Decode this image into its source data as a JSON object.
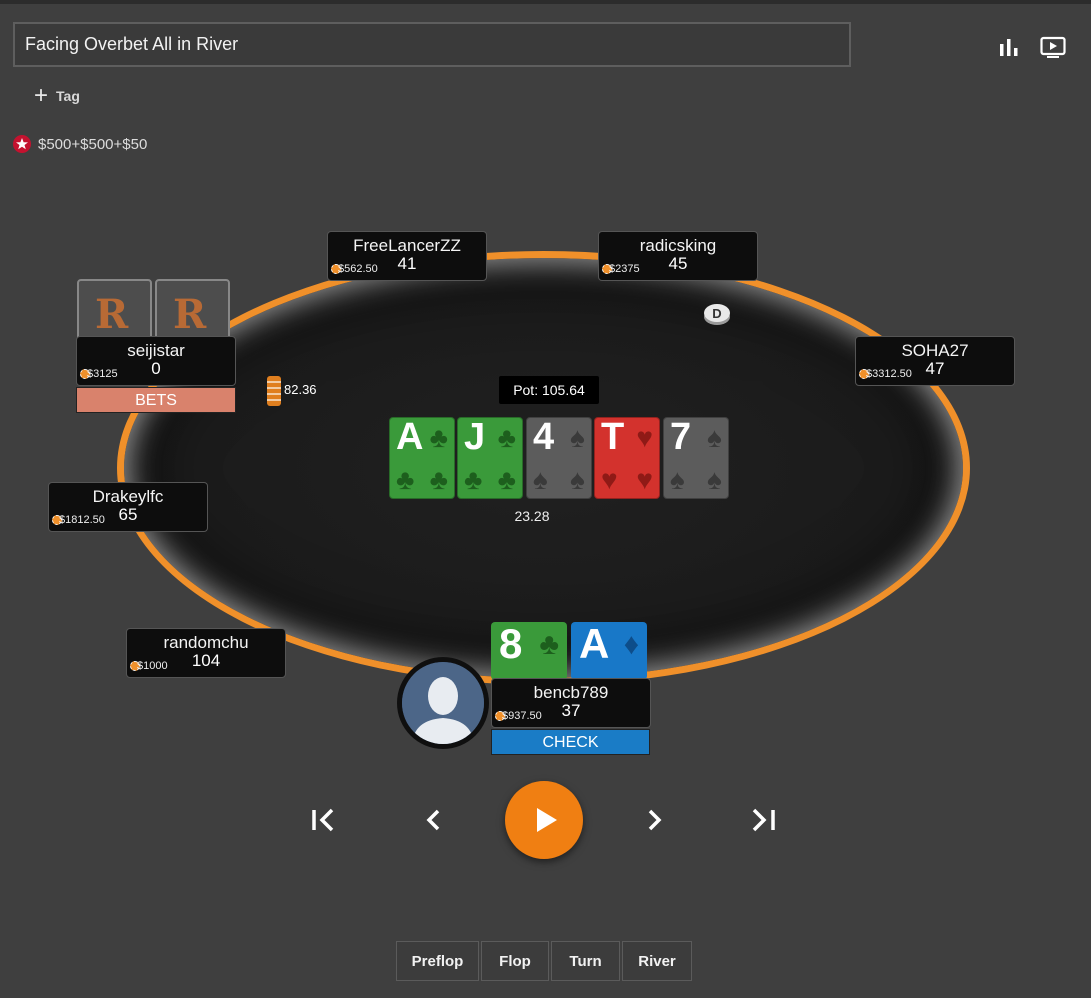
{
  "header": {
    "title": "Facing Overbet All in River",
    "stats_icon": "bar-chart-icon",
    "replay_icon": "play-screen-icon"
  },
  "tag": {
    "label": "Tag"
  },
  "stakes": {
    "text": "$500+$500+$50",
    "icon": "pokerstars-star-icon"
  },
  "table": {
    "pot": "Pot: 105.64",
    "effective": "23.28",
    "bet_amount": "82.36",
    "felt_color": "#1b1b1b",
    "rail_color": "#f0902a"
  },
  "players": {
    "freelancer": {
      "name": "FreeLancerZZ",
      "stack": "$562.50",
      "bb": "41"
    },
    "radicsking": {
      "name": "radicsking",
      "stack": "$2375",
      "bb": "45"
    },
    "seijistar": {
      "name": "seijistar",
      "stack": "$3125",
      "bb": "0",
      "action": "BETS"
    },
    "soha27": {
      "name": "SOHA27",
      "stack": "$3312.50",
      "bb": "47"
    },
    "drakeylfc": {
      "name": "Drakeylfc",
      "stack": "$1812.50",
      "bb": "65"
    },
    "randomchu": {
      "name": "randomchu",
      "stack": "$1000",
      "bb": "104"
    },
    "bencb789": {
      "name": "bencb789",
      "stack": "$937.50",
      "bb": "37",
      "action": "CHECK"
    }
  },
  "board": [
    {
      "rank": "A",
      "suit": "♣",
      "suit_name": "clubs"
    },
    {
      "rank": "J",
      "suit": "♣",
      "suit_name": "clubs"
    },
    {
      "rank": "4",
      "suit": "♠",
      "suit_name": "spades"
    },
    {
      "rank": "T",
      "suit": "♥",
      "suit_name": "hearts"
    },
    {
      "rank": "7",
      "suit": "♠",
      "suit_name": "spades"
    }
  ],
  "hero_cards": [
    {
      "rank": "8",
      "suit": "♣",
      "suit_name": "clubs"
    },
    {
      "rank": "A",
      "suit": "♦",
      "suit_name": "diamonds"
    }
  ],
  "villain_cards": {
    "logo": "R"
  },
  "controls": {
    "first": "first-icon",
    "prev": "prev-icon",
    "play": "play-icon",
    "next": "next-icon",
    "last": "last-icon"
  },
  "streets": [
    "Preflop",
    "Flop",
    "Turn",
    "River"
  ]
}
